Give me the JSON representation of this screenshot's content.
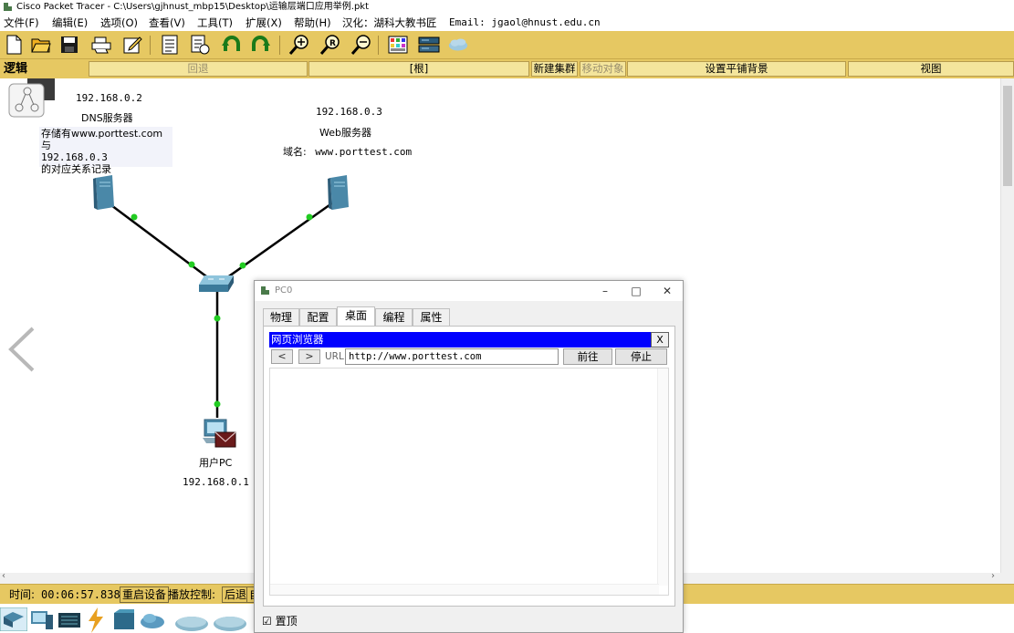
{
  "title_bar": {
    "text": "Cisco Packet Tracer - C:\\Users\\gjhnust_mbp15\\Desktop\\运输层端口应用举例.pkt"
  },
  "menu": {
    "file": "文件(F)",
    "edit": "编辑(E)",
    "options": "选项(O)",
    "view": "查看(V)",
    "tools": "工具(T)",
    "extensions": "扩展(X)",
    "help": "帮助(H)",
    "localized": "汉化：湖科大教书匠",
    "email": "Email: jgaol@hnust.edu.cn"
  },
  "toolbar": {
    "icons": [
      "new-file-icon",
      "open-folder-icon",
      "save-icon",
      "print-icon",
      "edit-icon",
      "activity-wizard-icon",
      "report-icon",
      "undo-icon",
      "redo-icon",
      "zoom-in-icon",
      "zoom-reset-icon",
      "zoom-out-icon",
      "palette-icon",
      "custom-device-icon",
      "cloud-icon"
    ]
  },
  "logic_bar": {
    "label": "逻辑",
    "back": "回退",
    "root": "[根]",
    "new_cluster": "新建集群",
    "move_object": "移动对象",
    "set_tiled_bg": "设置平铺背景",
    "viewport": "视图"
  },
  "topology": {
    "dns_server": {
      "ip": "192.168.0.2",
      "name": "DNS服务器",
      "note_line1": "存储有www.porttest.com与",
      "note_line2": "192.168.0.3",
      "note_line3": "的对应关系记录"
    },
    "web_server": {
      "ip": "192.168.0.3",
      "name": "Web服务器",
      "domain_label": "域名:",
      "domain": "www.porttest.com"
    },
    "user_pc": {
      "name": "用户PC",
      "ip": "192.168.0.1"
    }
  },
  "status_bar": {
    "time_label": "时间:",
    "time": "00:06:57.838",
    "reset": "重启设备",
    "playback": "播放控制:",
    "back": "后退",
    "next": "自"
  },
  "pc0_window": {
    "title": "PC0",
    "tabs": [
      "物理",
      "配置",
      "桌面",
      "编程",
      "属性"
    ],
    "active_tab": "桌面",
    "browser_title": "网页浏览器",
    "close": "X",
    "back": "<",
    "forward": ">",
    "url_label": "URL",
    "url": "http://www.porttest.com",
    "go": "前往",
    "stop": "停止",
    "always_on_top": "置顶"
  },
  "colors": {
    "toolbar": "#e6c862",
    "browser_header": "#0000ff",
    "link_light": "#22cc22"
  }
}
